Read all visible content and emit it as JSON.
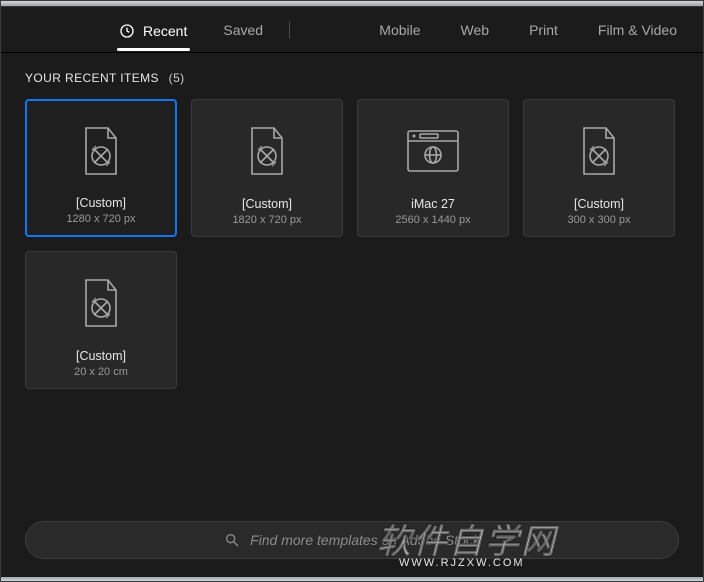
{
  "tabs": {
    "recent": "Recent",
    "saved": "Saved",
    "mobile": "Mobile",
    "web": "Web",
    "print": "Print",
    "filmvideo": "Film & Video"
  },
  "section": {
    "title": "YOUR RECENT ITEMS",
    "count": "(5)"
  },
  "items": [
    {
      "label": "[Custom]",
      "sub": "1280 x 720 px",
      "type": "doc",
      "selected": true
    },
    {
      "label": "[Custom]",
      "sub": "1820 x 720 px",
      "type": "doc",
      "selected": false
    },
    {
      "label": "iMac 27",
      "sub": "2560 x 1440 px",
      "type": "web",
      "selected": false
    },
    {
      "label": "[Custom]",
      "sub": "300 x 300 px",
      "type": "doc",
      "selected": false
    },
    {
      "label": "[Custom]",
      "sub": "20 x 20 cm",
      "type": "doc",
      "selected": false
    }
  ],
  "search": {
    "placeholder": "Find more templates on Adobe Stock"
  },
  "watermark": {
    "text": "软件自学网",
    "url": "WWW.RJZXW.COM"
  },
  "colors": {
    "accent": "#1374f6",
    "bg": "#1b1b1b",
    "card": "#282828"
  }
}
